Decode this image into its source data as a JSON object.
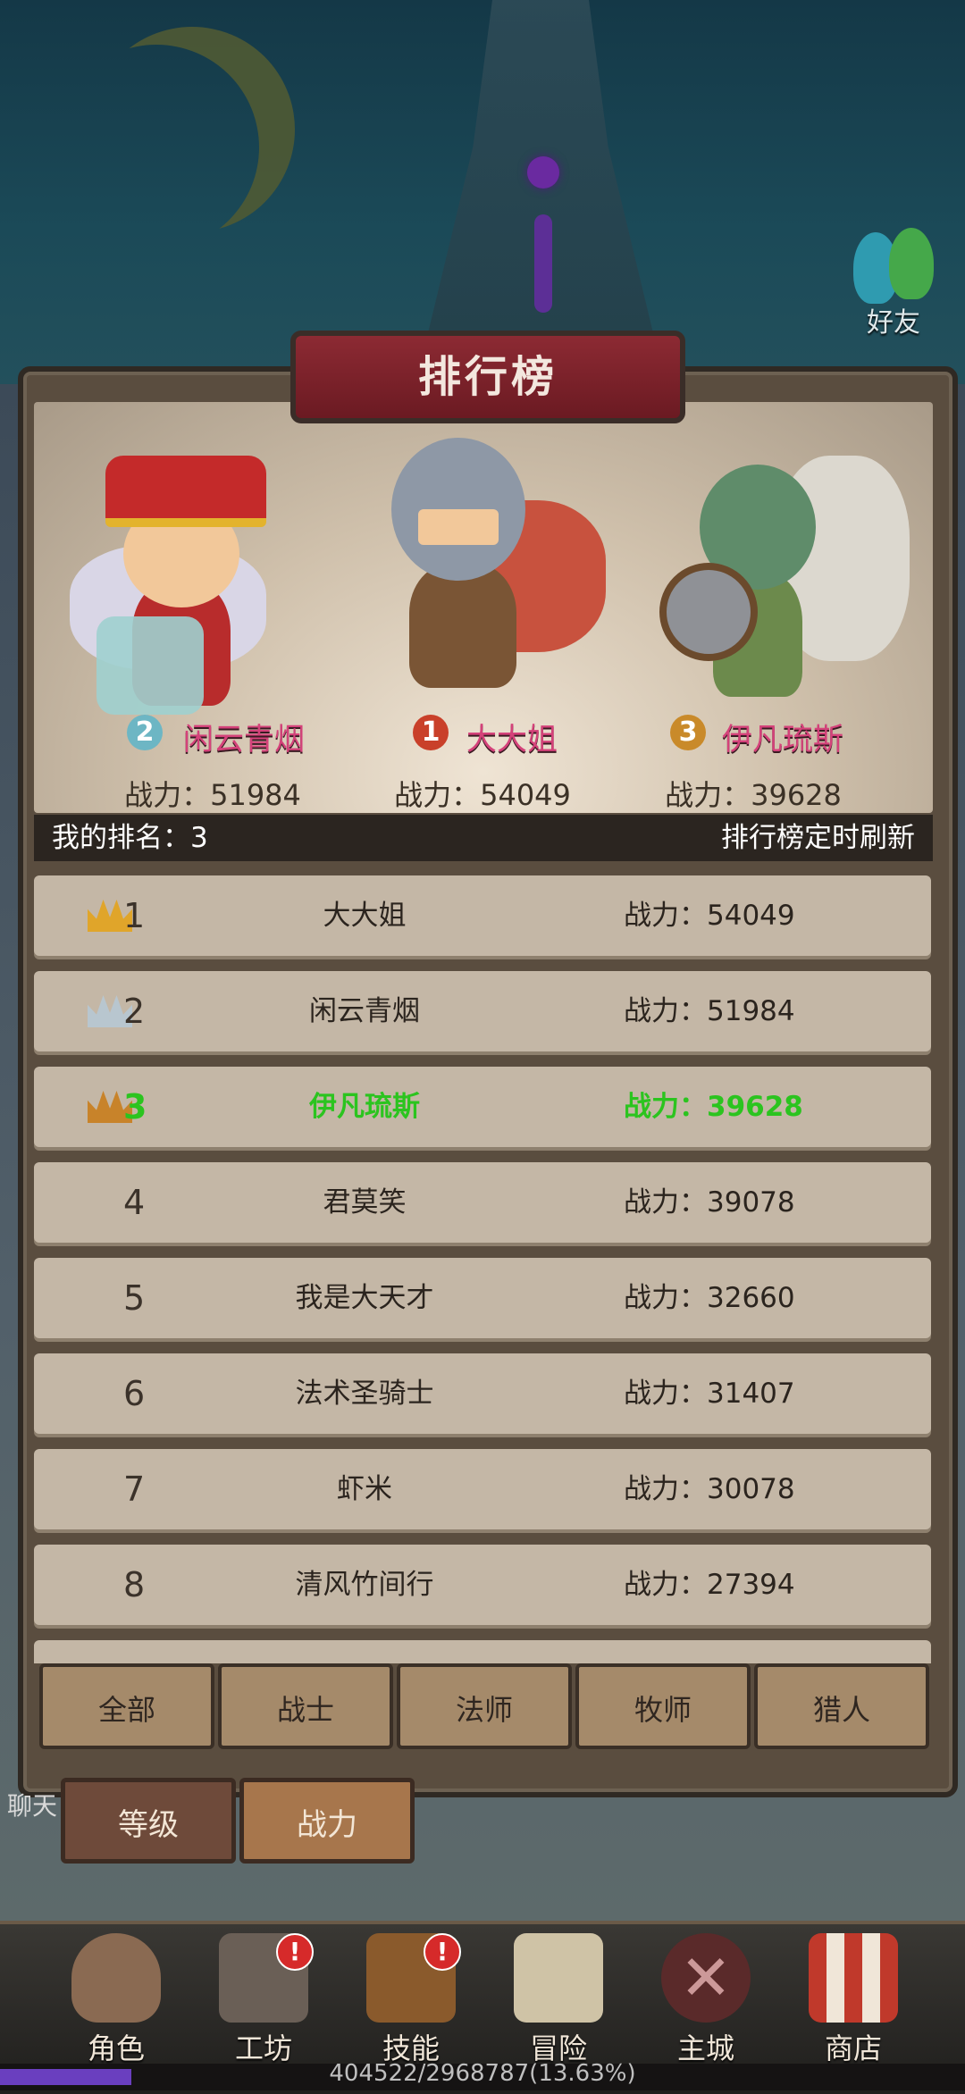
{
  "friends": {
    "label": "好友"
  },
  "panel": {
    "title": "排行榜"
  },
  "podium": [
    {
      "rank": "2",
      "name": "闲云青烟",
      "power": "战力：51984"
    },
    {
      "rank": "1",
      "name": "大大姐",
      "power": "战力：54049"
    },
    {
      "rank": "3",
      "name": "伊凡琉斯",
      "power": "战力：39628"
    }
  ],
  "my_rank": {
    "label": "我的排名：3",
    "refresh_note": "排行榜定时刷新"
  },
  "rows": [
    {
      "rank": "1",
      "name": "大大姐",
      "power": "战力：54049"
    },
    {
      "rank": "2",
      "name": "闲云青烟",
      "power": "战力：51984"
    },
    {
      "rank": "3",
      "name": "伊凡琉斯",
      "power": "战力：39628"
    },
    {
      "rank": "4",
      "name": "君莫笑",
      "power": "战力：39078"
    },
    {
      "rank": "5",
      "name": "我是大天才",
      "power": "战力：32660"
    },
    {
      "rank": "6",
      "name": "法术圣骑士",
      "power": "战力：31407"
    },
    {
      "rank": "7",
      "name": "虾米",
      "power": "战力：30078"
    },
    {
      "rank": "8",
      "name": "清风竹间行",
      "power": "战力：27394"
    }
  ],
  "class_tabs": [
    "全部",
    "战士",
    "法师",
    "牧师",
    "猎人"
  ],
  "sort_tabs": [
    "等级",
    "战力"
  ],
  "chat": {
    "label": "聊天"
  },
  "nav": [
    {
      "label": "角色",
      "icon": "character-icon",
      "badge": ""
    },
    {
      "label": "工坊",
      "icon": "workshop-icon",
      "badge": "!"
    },
    {
      "label": "技能",
      "icon": "skill-book-icon",
      "badge": "!"
    },
    {
      "label": "冒险",
      "icon": "adventure-map-icon",
      "badge": ""
    },
    {
      "label": "主城",
      "icon": "main-city-icon",
      "badge": ""
    },
    {
      "label": "商店",
      "icon": "shop-icon",
      "badge": ""
    }
  ],
  "xp": {
    "text": "404522/2968787(13.63%)",
    "fraction": 0.1363
  },
  "colors": {
    "highlight_green": "#2bc41f",
    "podium_name_pink": "#d4427a",
    "title_red": "#8c2a33"
  }
}
